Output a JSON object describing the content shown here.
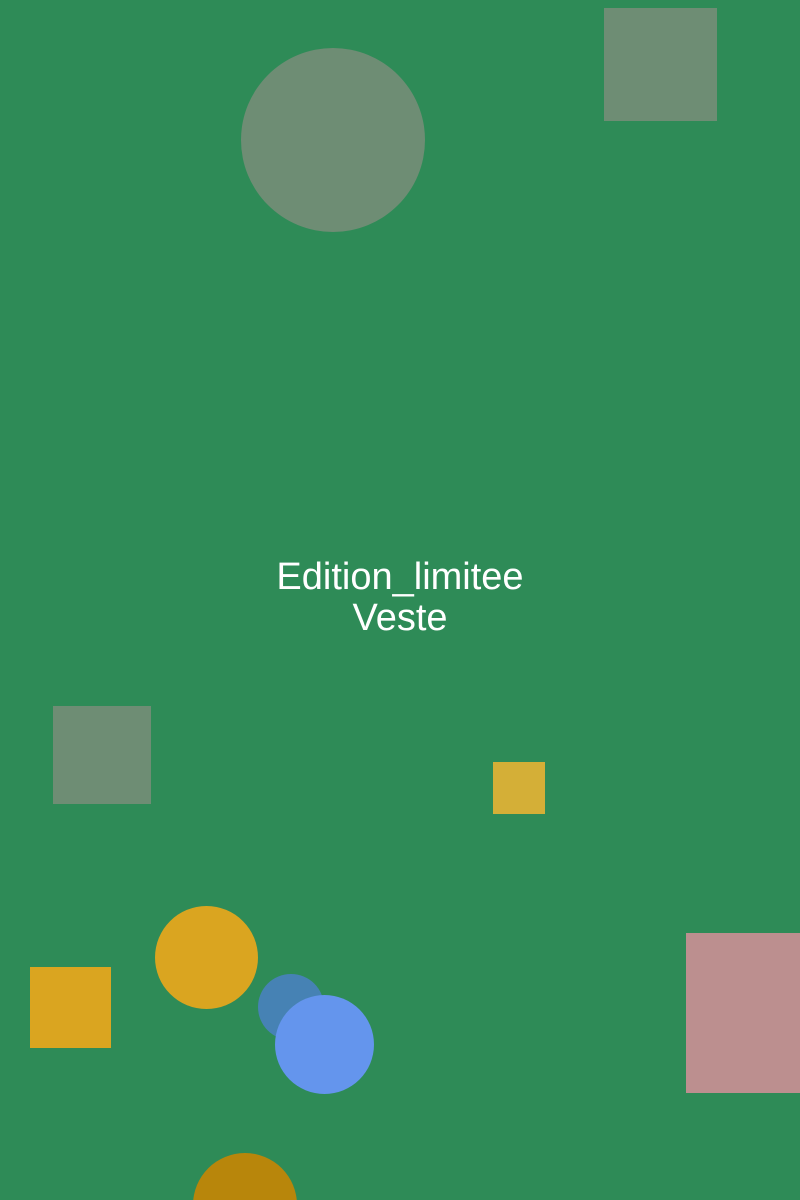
{
  "title": {
    "line1": "Edition_limitee",
    "line2": "Veste"
  },
  "colors": {
    "background": "#2e8b57",
    "text": "#ffffff",
    "gray_green": "#6e8d74",
    "gold": "#daa520",
    "mustard": "#d4af37",
    "dark_gold": "#b8860b",
    "steel_blue": "#4682b4",
    "cornflower_blue": "#6495ed",
    "rosy_brown": "#bc8f8f"
  }
}
